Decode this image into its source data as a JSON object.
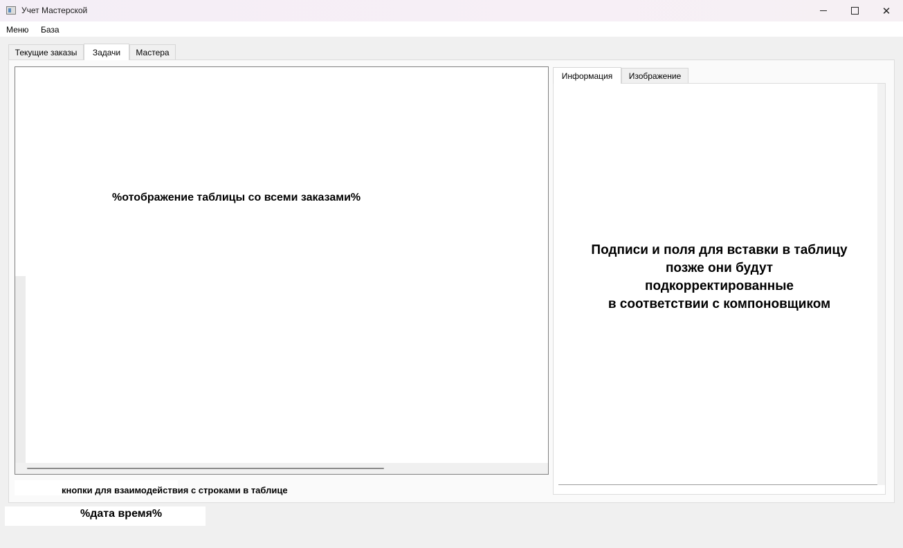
{
  "window": {
    "title": "Учет Мастерской",
    "minimize_icon": "minimize-icon",
    "maximize_icon": "maximize-icon",
    "close_icon": "close-icon"
  },
  "menubar": {
    "items": [
      "Меню",
      "База"
    ]
  },
  "main_tabs": [
    {
      "label": "Текущие заказы",
      "active": false
    },
    {
      "label": "Задачи",
      "active": true
    },
    {
      "label": "Мастера",
      "active": false
    }
  ],
  "table_panel": {
    "placeholder": "%отображение таблицы со всеми заказами%"
  },
  "buttons_panel": {
    "placeholder": "кнопки для взаимодействия с строками в таблице"
  },
  "side_tabs": [
    {
      "label": "Информация",
      "active": true
    },
    {
      "label": "Изображение",
      "active": false
    }
  ],
  "side_panel": {
    "lines": [
      "Подписи и поля для вставки в таблицу",
      "позже они будут",
      "подкорректированные",
      "в соответствии с компоновщиком"
    ]
  },
  "status": {
    "datetime_placeholder": "%дата время%"
  }
}
